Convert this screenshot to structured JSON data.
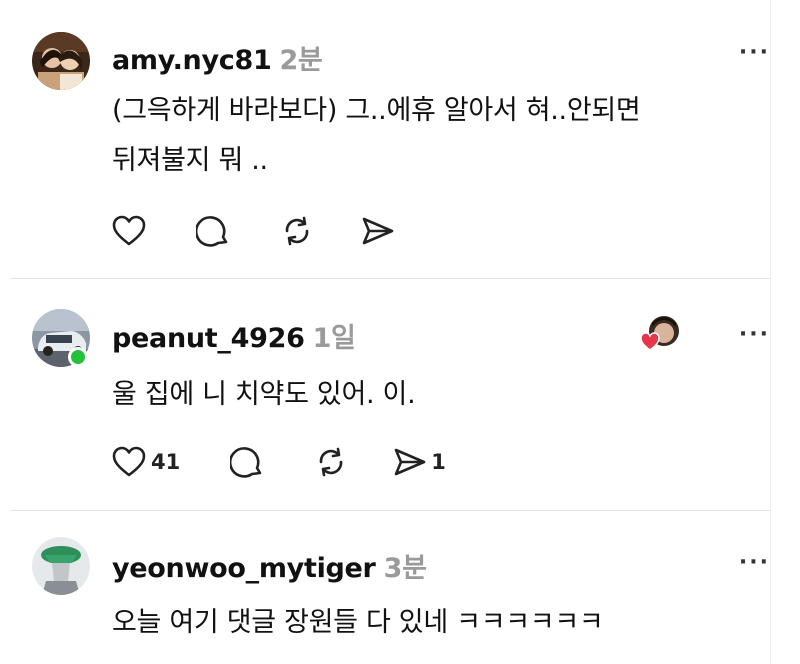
{
  "posts": [
    {
      "username": "amy.nyc81",
      "time": "2분",
      "text": "(그윽하게 바라보다) 그..에휴 알아서 혀..안되면\n뒤져불지 뭐 ..",
      "like_count": "",
      "repost_count": "",
      "share_count": ""
    },
    {
      "username": "peanut_4926",
      "time": "1일",
      "text": "울 집에 니 치약도 있어. 이.",
      "like_count": "41",
      "repost_count": "",
      "share_count": "1"
    },
    {
      "username": "yeonwoo_mytiger",
      "time": "3분",
      "text": "오늘 여기 댓글 장원들 다 있네 ㅋㅋㅋㅋㅋㅋ"
    }
  ],
  "more_symbol": "···",
  "icons": [
    "heart-icon",
    "comment-icon",
    "repost-icon",
    "share-icon",
    "more-icon",
    "online-status-icon"
  ],
  "colors": {
    "online": "#22c33a",
    "time": "#9a9a9a",
    "reaction_heart": "#e8364b"
  }
}
